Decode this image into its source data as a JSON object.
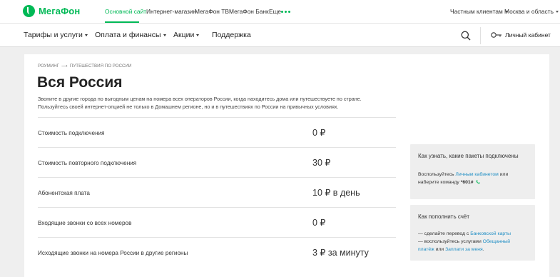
{
  "topbar": {
    "logo_text": "МегаФон",
    "links": [
      {
        "label": "Основной сайт",
        "active": true
      },
      {
        "label": "Интернет-магазин",
        "active": false
      },
      {
        "label": "МегаФон ТВ",
        "active": false
      },
      {
        "label": "МегаФон Банк",
        "active": false
      },
      {
        "label": "Еще",
        "active": false
      }
    ],
    "segment": "Частным клиентам",
    "region": "Москва и область"
  },
  "nav": {
    "items": [
      "Тарифы и услуги",
      "Оплата и финансы",
      "Акции",
      "Поддержка"
    ],
    "cabinet_label": "Личный кабинет"
  },
  "breadcrumb": [
    "Роуминг",
    "Путешествия по России"
  ],
  "page": {
    "title": "Вся Россия",
    "lead_line1": "Звоните в другие города по выгодным ценам на номера всех операторов России, когда находитесь дома или путешествуете по стране.",
    "lead_line2": "Пользуйтесь своей интернет-опцией не только в Домашнем регионе, но и в путешествиях по России на привычных условиях."
  },
  "prices": [
    {
      "label": "Стоимость подключения",
      "value": "0 ₽"
    },
    {
      "label": "Стоимость повторного подключения",
      "value": "30 ₽"
    },
    {
      "label": "Абонентская плата",
      "value": "10 ₽ в день"
    },
    {
      "label": "Входящие звонки со всех номеров",
      "value": "0 ₽"
    },
    {
      "label": "Исходящие звонки на номера России в другие регионы",
      "value": "3 ₽ за минуту"
    }
  ],
  "info_packages": {
    "title": "Как узнать, какие пакеты подключены",
    "line1_prefix": "Воспользуйтесь ",
    "line1_link": "Личным кабинетом",
    "line1_suffix": " или",
    "line2_prefix": "наберите команду ",
    "line2_code": "*601#"
  },
  "info_topup": {
    "title": "Как пополнить счёт",
    "line1_prefix": "— сделайте перевод с ",
    "line1_link": "Банковской карты",
    "line2_prefix": "— воспользуйтесь услугами ",
    "line2_link": "Обещанный",
    "line3_link1": "платёж",
    "line3_mid": " или ",
    "line3_link2": "Заплати за меня",
    "line3_suffix": "."
  },
  "colors": {
    "brand": "#00b956",
    "link": "#1f8ec4",
    "background": "#efefef"
  }
}
